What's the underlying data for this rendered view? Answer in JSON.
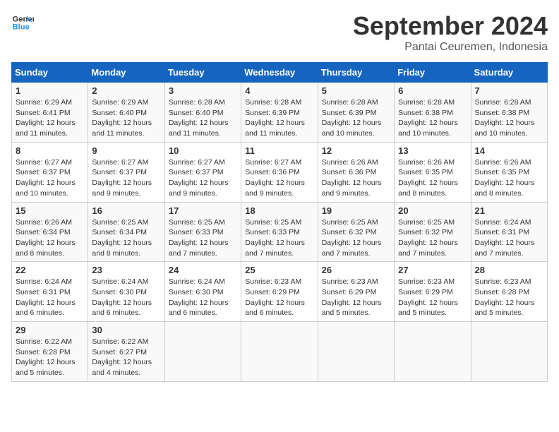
{
  "logo": {
    "line1": "General",
    "line2": "Blue"
  },
  "title": "September 2024",
  "subtitle": "Pantai Ceuremen, Indonesia",
  "days_of_week": [
    "Sunday",
    "Monday",
    "Tuesday",
    "Wednesday",
    "Thursday",
    "Friday",
    "Saturday"
  ],
  "weeks": [
    [
      {
        "day": 1,
        "rise": "6:29 AM",
        "set": "6:41 PM",
        "hours": "12 hours and 11 minutes."
      },
      {
        "day": 2,
        "rise": "6:29 AM",
        "set": "6:40 PM",
        "hours": "12 hours and 11 minutes."
      },
      {
        "day": 3,
        "rise": "6:28 AM",
        "set": "6:40 PM",
        "hours": "12 hours and 11 minutes."
      },
      {
        "day": 4,
        "rise": "6:28 AM",
        "set": "6:39 PM",
        "hours": "12 hours and 11 minutes."
      },
      {
        "day": 5,
        "rise": "6:28 AM",
        "set": "6:39 PM",
        "hours": "12 hours and 10 minutes."
      },
      {
        "day": 6,
        "rise": "6:28 AM",
        "set": "6:38 PM",
        "hours": "12 hours and 10 minutes."
      },
      {
        "day": 7,
        "rise": "6:28 AM",
        "set": "6:38 PM",
        "hours": "12 hours and 10 minutes."
      }
    ],
    [
      {
        "day": 8,
        "rise": "6:27 AM",
        "set": "6:37 PM",
        "hours": "12 hours and 10 minutes."
      },
      {
        "day": 9,
        "rise": "6:27 AM",
        "set": "6:37 PM",
        "hours": "12 hours and 9 minutes."
      },
      {
        "day": 10,
        "rise": "6:27 AM",
        "set": "6:37 PM",
        "hours": "12 hours and 9 minutes."
      },
      {
        "day": 11,
        "rise": "6:27 AM",
        "set": "6:36 PM",
        "hours": "12 hours and 9 minutes."
      },
      {
        "day": 12,
        "rise": "6:26 AM",
        "set": "6:36 PM",
        "hours": "12 hours and 9 minutes."
      },
      {
        "day": 13,
        "rise": "6:26 AM",
        "set": "6:35 PM",
        "hours": "12 hours and 8 minutes."
      },
      {
        "day": 14,
        "rise": "6:26 AM",
        "set": "6:35 PM",
        "hours": "12 hours and 8 minutes."
      }
    ],
    [
      {
        "day": 15,
        "rise": "6:26 AM",
        "set": "6:34 PM",
        "hours": "12 hours and 8 minutes."
      },
      {
        "day": 16,
        "rise": "6:25 AM",
        "set": "6:34 PM",
        "hours": "12 hours and 8 minutes."
      },
      {
        "day": 17,
        "rise": "6:25 AM",
        "set": "6:33 PM",
        "hours": "12 hours and 7 minutes."
      },
      {
        "day": 18,
        "rise": "6:25 AM",
        "set": "6:33 PM",
        "hours": "12 hours and 7 minutes."
      },
      {
        "day": 19,
        "rise": "6:25 AM",
        "set": "6:32 PM",
        "hours": "12 hours and 7 minutes."
      },
      {
        "day": 20,
        "rise": "6:25 AM",
        "set": "6:32 PM",
        "hours": "12 hours and 7 minutes."
      },
      {
        "day": 21,
        "rise": "6:24 AM",
        "set": "6:31 PM",
        "hours": "12 hours and 7 minutes."
      }
    ],
    [
      {
        "day": 22,
        "rise": "6:24 AM",
        "set": "6:31 PM",
        "hours": "12 hours and 6 minutes."
      },
      {
        "day": 23,
        "rise": "6:24 AM",
        "set": "6:30 PM",
        "hours": "12 hours and 6 minutes."
      },
      {
        "day": 24,
        "rise": "6:24 AM",
        "set": "6:30 PM",
        "hours": "12 hours and 6 minutes."
      },
      {
        "day": 25,
        "rise": "6:23 AM",
        "set": "6:29 PM",
        "hours": "12 hours and 6 minutes."
      },
      {
        "day": 26,
        "rise": "6:23 AM",
        "set": "6:29 PM",
        "hours": "12 hours and 5 minutes."
      },
      {
        "day": 27,
        "rise": "6:23 AM",
        "set": "6:29 PM",
        "hours": "12 hours and 5 minutes."
      },
      {
        "day": 28,
        "rise": "6:23 AM",
        "set": "6:28 PM",
        "hours": "12 hours and 5 minutes."
      }
    ],
    [
      {
        "day": 29,
        "rise": "6:22 AM",
        "set": "6:28 PM",
        "hours": "12 hours and 5 minutes."
      },
      {
        "day": 30,
        "rise": "6:22 AM",
        "set": "6:27 PM",
        "hours": "12 hours and 4 minutes."
      },
      null,
      null,
      null,
      null,
      null
    ]
  ]
}
